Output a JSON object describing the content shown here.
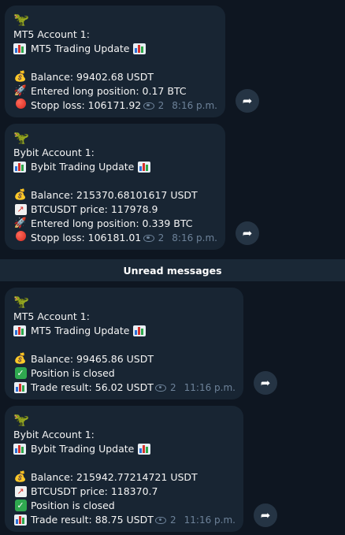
{
  "unread_label": "Unread messages",
  "icons": {
    "dino": "🦖",
    "bag": "💰",
    "rocket": "🚀"
  },
  "messages": [
    {
      "account": "MT5 Account 1:",
      "title": "MT5 Trading Update",
      "balance": "Balance: 99402.68 USDT",
      "entered": "Entered long position: 0.17 BTC",
      "stopp": "Stopp loss: 106171.92",
      "views": "2",
      "time": "8:16 p.m."
    },
    {
      "account": "Bybit Account 1:",
      "title": "Bybit Trading Update",
      "balance": "Balance: 215370.68101617 USDT",
      "price": "BTCUSDT price: 117978.9",
      "entered": "Entered long position: 0.339 BTC",
      "stopp": "Stopp loss: 106181.01",
      "views": "2",
      "time": "8:16 p.m."
    },
    {
      "account": "MT5 Account 1:",
      "title": "MT5 Trading Update",
      "balance": "Balance: 99465.86 USDT",
      "closed": "Position is closed",
      "result": "Trade result: 56.02 USDT",
      "views": "2",
      "time": "11:16 p.m."
    },
    {
      "account": "Bybit Account 1:",
      "title": "Bybit Trading Update",
      "balance": "Balance: 215942.77214721 USDT",
      "price": "BTCUSDT price: 118370.7",
      "closed": "Position is closed",
      "result": "Trade result: 88.75 USDT",
      "views": "2",
      "time": "11:16 p.m."
    }
  ]
}
